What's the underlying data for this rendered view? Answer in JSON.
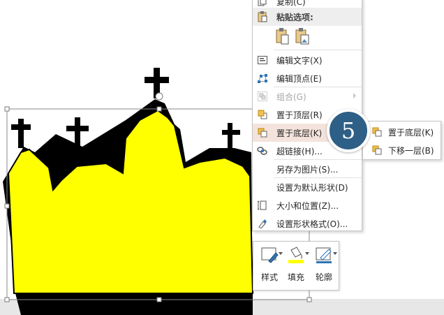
{
  "context_menu": {
    "items": [
      {
        "id": "copy",
        "label": "复制(C)",
        "icon": "copy-icon"
      },
      {
        "id": "paste-options",
        "label": "粘贴选项:",
        "icon": "paste-icon"
      },
      {
        "id": "edit-text",
        "label": "编辑文字(X)",
        "icon": "edit-text-icon"
      },
      {
        "id": "edit-points",
        "label": "编辑顶点(E)",
        "icon": "edit-points-icon"
      },
      {
        "id": "group",
        "label": "组合(G)",
        "icon": "group-icon",
        "disabled": true
      },
      {
        "id": "bring-to-front",
        "label": "置于顶层(R)",
        "icon": "bring-front-icon"
      },
      {
        "id": "send-to-back",
        "label": "置于底层(K)",
        "icon": "send-back-icon"
      },
      {
        "id": "hyperlink",
        "label": "超链接(H)...",
        "icon": "link-icon"
      },
      {
        "id": "save-as-picture",
        "label": "另存为图片(S)..."
      },
      {
        "id": "set-default-shape",
        "label": "设置为默认形状(D)"
      },
      {
        "id": "size-position",
        "label": "大小和位置(Z)...",
        "icon": "size-position-icon"
      },
      {
        "id": "format-shape",
        "label": "设置形状格式(O)...",
        "icon": "format-shape-icon"
      }
    ]
  },
  "submenu": {
    "items": [
      {
        "label": "置于底层(K)",
        "icon": "send-to-back-icon"
      },
      {
        "label": "下移一层(B)",
        "icon": "send-backward-icon"
      }
    ]
  },
  "step_badge": "5",
  "mini_toolbar": {
    "buttons": [
      {
        "label": "样式",
        "icon": "style-icon"
      },
      {
        "label": "填充",
        "icon": "fill-bucket-icon",
        "color": "#ffff00"
      },
      {
        "label": "轮廓",
        "icon": "outline-pen-icon"
      }
    ]
  },
  "colors": {
    "crown_fill": "#ffff00",
    "crown_outline": "#000000",
    "badge": "#2e5f86",
    "menu_hover": "#f4e3dc"
  }
}
